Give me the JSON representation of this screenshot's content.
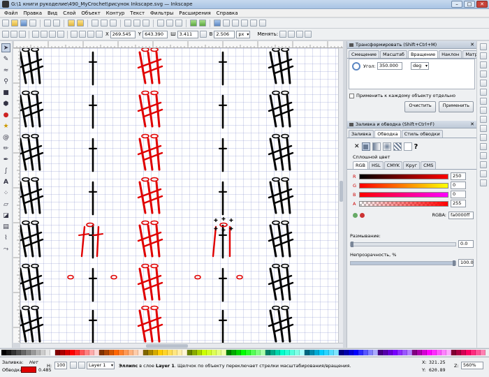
{
  "window": {
    "title": "G:\\1 книги рукоделие\\490_MyCrochet\\рисунок Inkscape.svg — Inkscape",
    "min_label": "–",
    "max_label": "□",
    "close_label": "✕"
  },
  "menu": [
    "Файл",
    "Правка",
    "Вид",
    "Слой",
    "Объект",
    "Контур",
    "Текст",
    "Фильтры",
    "Расширения",
    "Справка"
  ],
  "controls": {
    "x_label": "X",
    "x_value": "269.545",
    "y_label": "Y",
    "y_value": "643.390",
    "w_label": "Ш",
    "w_value": "3.411",
    "h_label": "В",
    "h_value": "2.506",
    "unit": "px",
    "change_label": "Менять:"
  },
  "transform_panel": {
    "title": "Трансформировать (Shift+Ctrl+M)",
    "tabs": [
      "Смещение",
      "Масштаб",
      "Вращение",
      "Наклон",
      "Матрица"
    ],
    "active_tab": 2,
    "angle_label": "Угол:",
    "angle_value": "350.000",
    "angle_unit": "deg",
    "apply_each_label": "Применить к каждому объекту отдельно",
    "clear_label": "Очистить",
    "apply_label": "Применить"
  },
  "fill_panel": {
    "title": "Заливка и обводка (Shift+Ctrl+F)",
    "tabs": [
      "Заливка",
      "Обводка",
      "Стиль обводки"
    ],
    "active_tab": 1,
    "unknown_label": "?",
    "none_label": "✕",
    "flat_label": "Сплошной цвет",
    "modes": [
      "RGB",
      "HSL",
      "CMYK",
      "Круг",
      "CMS"
    ],
    "active_mode": 0,
    "channels": [
      {
        "name": "R",
        "value": "250"
      },
      {
        "name": "G",
        "value": "0"
      },
      {
        "name": "B",
        "value": "0"
      },
      {
        "name": "A",
        "value": "255"
      }
    ],
    "rgba_label": "RGBA:",
    "rgba_value": "fa0000ff",
    "blur_label": "Размывание:",
    "blur_value": "0.0",
    "opacity_label": "Непрозрачность, %",
    "opacity_value": "100.0"
  },
  "status": {
    "fill_label": "Заливка:",
    "fill_value": "Нет",
    "stroke_label": "Обводка:",
    "stroke_width": "0.485",
    "h_label": "Н:",
    "h_value": "100",
    "layer": "Layer 1",
    "message_bold": "Эллипс",
    "message": " в слое ",
    "message_layer": "Layer 1",
    "message_rest": ". Щелчок по объекту переключает стрелки масштабирования/вращения.",
    "x_label": "X:",
    "x_value": "321.25",
    "y_label": "Y:",
    "y_value": "620.89",
    "z_label": "Z:",
    "zoom": "560%"
  },
  "colors": {
    "accent_red": "#e00000",
    "black": "#000000"
  }
}
